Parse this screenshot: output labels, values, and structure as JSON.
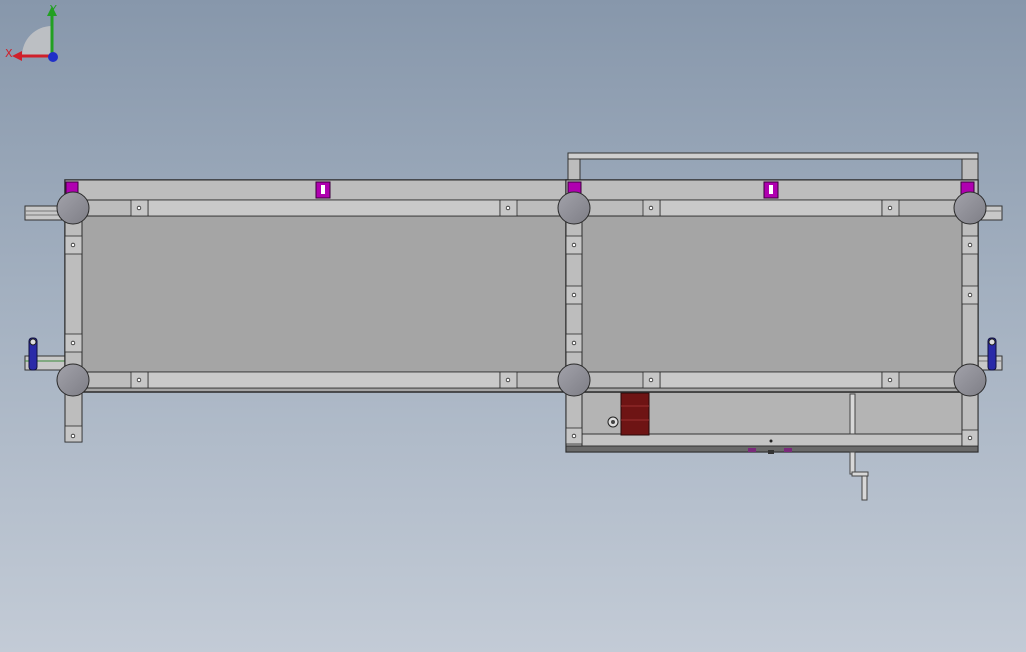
{
  "view": {
    "triad": {
      "x_label": "X",
      "y_label": "Y",
      "colors": {
        "x": "#d0202a",
        "y": "#22a022",
        "z": "#2030c8"
      }
    },
    "colors": {
      "background_top": "#8797ab",
      "background_bottom": "#c3cbd6",
      "panel": "#a5a5a5",
      "frame": "#bdbdbd",
      "edge": "#2a2a2a",
      "foot": "#8e8e94",
      "clamp": "#b000b0",
      "motor": "#6e1414",
      "handle": "#2a2aa8"
    }
  }
}
